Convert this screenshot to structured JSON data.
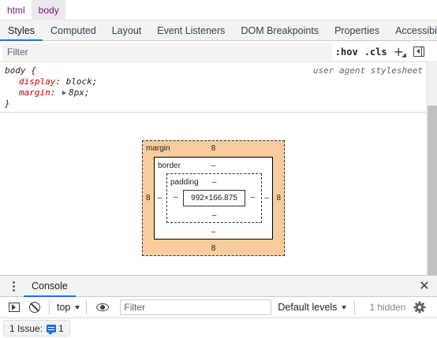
{
  "breadcrumbs": [
    "html",
    "body"
  ],
  "tabs": [
    "Styles",
    "Computed",
    "Layout",
    "Event Listeners",
    "DOM Breakpoints",
    "Properties",
    "Accessibility"
  ],
  "filter": {
    "placeholder": "Filter",
    "hov": ":hov",
    "cls": ".cls",
    "plus": "+"
  },
  "rule": {
    "selector": "body {",
    "source": "user agent stylesheet",
    "declarations": [
      {
        "name": "display",
        "value": "block;"
      },
      {
        "name": "margin",
        "value": "8px;"
      }
    ],
    "close": "}"
  },
  "box_model": {
    "margin_label": "margin",
    "margin_top": "8",
    "margin_bottom": "8",
    "margin_left": "8",
    "margin_right": "8",
    "border_label": "border",
    "border_top": "–",
    "border_bottom": "–",
    "border_left": "–",
    "border_right": "–",
    "padding_label": "padding",
    "padding_top": "–",
    "padding_bottom": "–",
    "padding_left": "–",
    "padding_right": "–",
    "content": "992×166.875"
  },
  "drawer": {
    "tab": "Console",
    "close": "✕"
  },
  "console": {
    "context": "top",
    "filter_placeholder": "Filter",
    "levels": "Default levels",
    "hidden": "1 hidden"
  },
  "issues": {
    "label": "1 Issue:",
    "count": "1"
  },
  "colors": {
    "accent": "#1a73e8",
    "margin_box": "#f9cc9d",
    "element_name": "#881280",
    "property_name": "#c80000"
  }
}
